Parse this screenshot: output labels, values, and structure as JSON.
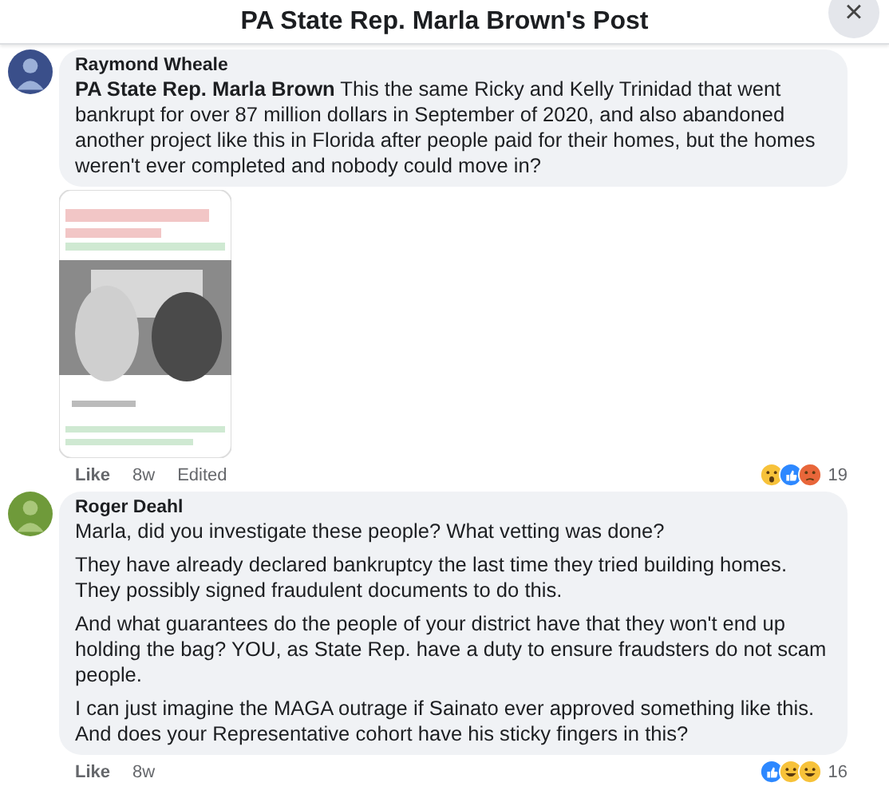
{
  "header": {
    "title": "PA State Rep. Marla Brown's Post",
    "close": "×"
  },
  "comments": [
    {
      "author": "Raymond Wheale",
      "paragraphs": [
        "**PA State Rep. Marla Brown** This the same Ricky and Kelly Trinidad that went bankrupt for over 87 million dollars in September of 2020, and also abandoned another project like this in Florida after people paid for their homes, but the homes weren't ever completed and nobody could move in?"
      ],
      "attachment": {
        "kind": "picture"
      },
      "actions": [
        "Like",
        "8w",
        "Edited"
      ],
      "reactions": [
        {
          "kind": "wow"
        },
        {
          "kind": "like"
        },
        {
          "kind": "angry"
        }
      ],
      "reaction_count": "19"
    },
    {
      "author": "Roger Deahl",
      "paragraphs": [
        "Marla, did you investigate these people? What vetting was done?",
        "They have already declared bankruptcy the last time they tried building homes. They possibly signed fraudulent documents to do this.",
        "And what guarantees do the people of your district have that they won't end up holding the bag? YOU, as State Rep. have a duty to ensure fraudsters do not scam people.",
        "I can just imagine the MAGA outrage if Sainato ever approved something like this. And does your Representative cohort have his sticky fingers in this?"
      ],
      "actions": [
        "Like",
        "8w"
      ],
      "reactions": [
        {
          "kind": "like"
        },
        {
          "kind": "haha"
        },
        {
          "kind": "haha"
        }
      ],
      "reaction_count": "16"
    }
  ]
}
